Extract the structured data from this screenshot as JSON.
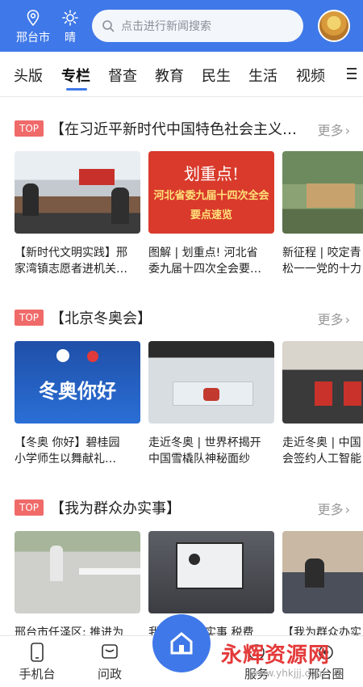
{
  "header": {
    "location_label": "邢台市",
    "weather_label": "晴",
    "search_placeholder": "点击进行新闻搜索"
  },
  "tabs": [
    {
      "label": "头版"
    },
    {
      "label": "专栏"
    },
    {
      "label": "督查"
    },
    {
      "label": "教育"
    },
    {
      "label": "民生"
    },
    {
      "label": "生活"
    },
    {
      "label": "视频"
    }
  ],
  "sections": [
    {
      "tag": "TOP",
      "title": "【在习近平新时代中国特色社会主义…",
      "more": "更多",
      "cards": [
        {
          "caption_line1": "【新时代文明实践】邢",
          "caption_line2": "家湾镇志愿者进机关…"
        },
        {
          "caption_line1": "图解 | 划重点! 河北省",
          "caption_line2": "委九届十四次全会要…",
          "image_text1": "划重点!",
          "image_text2": "河北省委九届十四次全会",
          "image_text3": "要点速览"
        },
        {
          "caption_line1": "新征程 | 咬定青",
          "caption_line2": "松一一党的十力"
        }
      ]
    },
    {
      "tag": "TOP",
      "title": "【北京冬奥会】",
      "more": "更多",
      "cards": [
        {
          "caption_line1": "【冬奥 你好】碧桂园",
          "caption_line2": "小学师生以舞献礼…",
          "image_text1": "冬奥你好"
        },
        {
          "caption_line1": "走近冬奥 | 世界杯揭开",
          "caption_line2": "中国雪橇队神秘面纱"
        },
        {
          "caption_line1": "走近冬奥 | 中国",
          "caption_line2": "会签约人工智能"
        }
      ]
    },
    {
      "tag": "TOP",
      "title": "【我为群众办实事】",
      "more": "更多",
      "cards": [
        {
          "caption_line1": "邢台市任泽区: 推进为",
          "caption_line2": ""
        },
        {
          "caption_line1": "我为群众办实事 税费",
          "caption_line2": ""
        },
        {
          "caption_line1": "【我为群众办实",
          "caption_line2": ""
        }
      ]
    }
  ],
  "bottom_nav": [
    {
      "label": "手机台",
      "icon": "phone-icon"
    },
    {
      "label": "问政",
      "icon": "message-icon"
    },
    {
      "label": "首页",
      "icon": "home-icon"
    },
    {
      "label": "服务",
      "icon": "service-icon"
    },
    {
      "label": "邢台圈",
      "icon": "circle-icon"
    }
  ],
  "watermark": {
    "text": "永辉资源网",
    "url": "www.yhkjjj.com"
  },
  "colors": {
    "header_blue": "#3f78e8",
    "tag_red": "#f06a6a",
    "banner_red": "#d93a2b",
    "text": "#222222",
    "muted": "#999999"
  }
}
